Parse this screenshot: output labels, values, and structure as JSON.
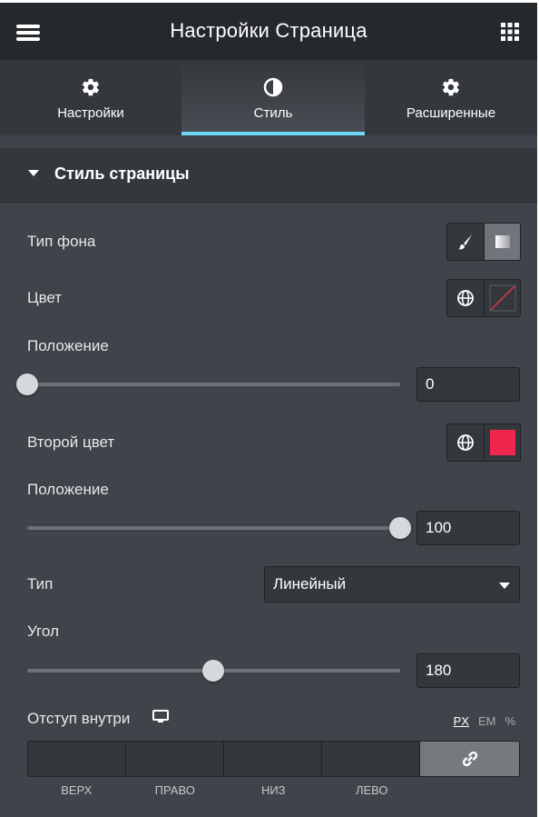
{
  "header": {
    "title": "Настройки Страница",
    "menu_icon": "hamburger-icon",
    "apps_icon": "grid-apps-icon"
  },
  "tabs": [
    {
      "label": "Настройки",
      "icon": "gear-icon",
      "active": false
    },
    {
      "label": "Стиль",
      "icon": "half-circle-icon",
      "active": true
    },
    {
      "label": "Расширенные",
      "icon": "gear-icon",
      "active": false
    }
  ],
  "section": {
    "title": "Стиль страницы"
  },
  "controls": {
    "background_type": {
      "label": "Тип фона",
      "options": [
        "brush-icon",
        "gradient-icon"
      ],
      "selected": "gradient-icon"
    },
    "color": {
      "label": "Цвет",
      "value": "none"
    },
    "position1": {
      "label": "Положение",
      "value": "0"
    },
    "second_color": {
      "label": "Второй цвет",
      "value": "#f0264e"
    },
    "position2": {
      "label": "Положение",
      "value": "100"
    },
    "type": {
      "label": "Тип",
      "value": "Линейный"
    },
    "angle": {
      "label": "Угол",
      "value": "180"
    },
    "padding": {
      "label": "Отступ внутри",
      "units": [
        "PX",
        "EM",
        "%"
      ],
      "active_unit": "PX",
      "fields": [
        "ВЕРХ",
        "ПРАВО",
        "НИЗ",
        "ЛЕВО"
      ]
    }
  },
  "colors": {
    "accent": "#71d7f7",
    "panel_bg": "#404349",
    "second_color_swatch": "#f0264e"
  }
}
